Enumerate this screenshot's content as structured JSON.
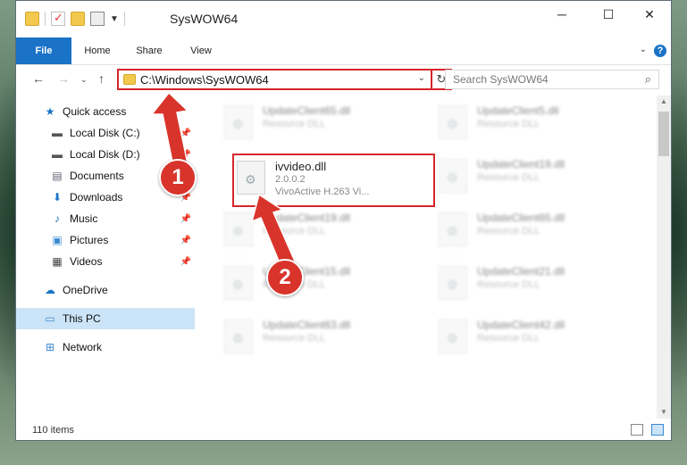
{
  "window": {
    "title": "SysWOW64"
  },
  "ribbon": {
    "tabs": [
      "File",
      "Home",
      "Share",
      "View"
    ],
    "help": "?"
  },
  "nav": {
    "address": "C:\\Windows\\SysWOW64",
    "search_placeholder": "Search SysWOW64"
  },
  "sidebar": {
    "items": [
      {
        "label": "Quick access"
      },
      {
        "label": "Local Disk (C:)"
      },
      {
        "label": "Local Disk (D:)"
      },
      {
        "label": "Documents"
      },
      {
        "label": "Downloads"
      },
      {
        "label": "Music"
      },
      {
        "label": "Pictures"
      },
      {
        "label": "Videos"
      },
      {
        "label": "OneDrive"
      },
      {
        "label": "This PC"
      },
      {
        "label": "Network"
      }
    ]
  },
  "files": {
    "blurred_left": [
      {
        "name": "UpdateClient65.dll",
        "desc": "Resource DLL"
      },
      {
        "name": "UpdateClient19.dll",
        "desc": "Resource DLL"
      },
      {
        "name": "UpdateClient15.dll",
        "desc": "Resource DLL"
      },
      {
        "name": "UpdateClient63.dll",
        "desc": "Resource DLL"
      }
    ],
    "blurred_right": [
      {
        "name": "UpdateClient5.dll",
        "desc": "Resource DLL"
      },
      {
        "name": "UpdateClient19.dll",
        "desc": "Resource DLL"
      },
      {
        "name": "UpdateClient65.dll",
        "desc": "Resource DLL"
      },
      {
        "name": "UpdateClient21.dll",
        "desc": "Resource DLL"
      },
      {
        "name": "UpdateClient42.dll",
        "desc": "Resource DLL"
      }
    ],
    "highlighted": {
      "name": "ivvideo.dll",
      "version": "2.0.0.2",
      "desc": "VivoActive H.263 Vi..."
    }
  },
  "status": {
    "count": "110 items"
  },
  "annotations": {
    "badge1": "1",
    "badge2": "2"
  },
  "colors": {
    "accent": "#1a73c7",
    "highlight": "#d6262a",
    "selected": "#cce4f7"
  }
}
